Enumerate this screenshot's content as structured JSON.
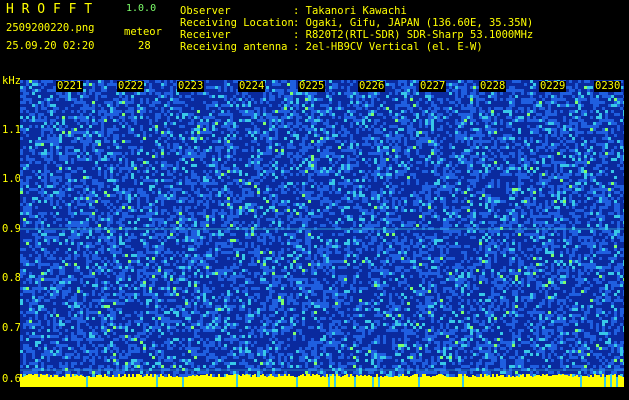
{
  "header": {
    "title": "H R O F F T",
    "version": "1.0.0",
    "filename": "2509200220.png",
    "meteor_label": "meteor",
    "datetime": "25.09.20 02:20",
    "meteor_count": "28"
  },
  "metadata": [
    {
      "label": "Observer",
      "value": ": Takanori Kawachi"
    },
    {
      "label": "Receiving Location",
      "value": ": Ogaki, Gifu, JAPAN (136.60E, 35.35N)"
    },
    {
      "label": "Receiver",
      "value": ": R820T2(RTL-SDR) SDR-Sharp 53.1000MHz"
    },
    {
      "label": "Receiving antenna",
      "value": ": 2el-HB9CV Vertical (el. E-W)"
    }
  ],
  "spectrogram": {
    "unit": "kHz",
    "y_ticks": [
      "1.1",
      "1.0",
      "0.9",
      "0.8",
      "0.7",
      "0.6"
    ],
    "time_labels": [
      "0221",
      "0222",
      "0223",
      "0224",
      "0225",
      "0226",
      "0227",
      "0228",
      "0229",
      "0230"
    ],
    "carrier_khz": 0.9,
    "colors": {
      "background": "#000000",
      "text": "#ffff00",
      "noise_dark": "#0a2a9e",
      "noise_mid": "#1f5fe0",
      "noise_high": "#37c8e8",
      "noise_peak": "#7dff6a",
      "baseline": "#ffff00"
    }
  }
}
